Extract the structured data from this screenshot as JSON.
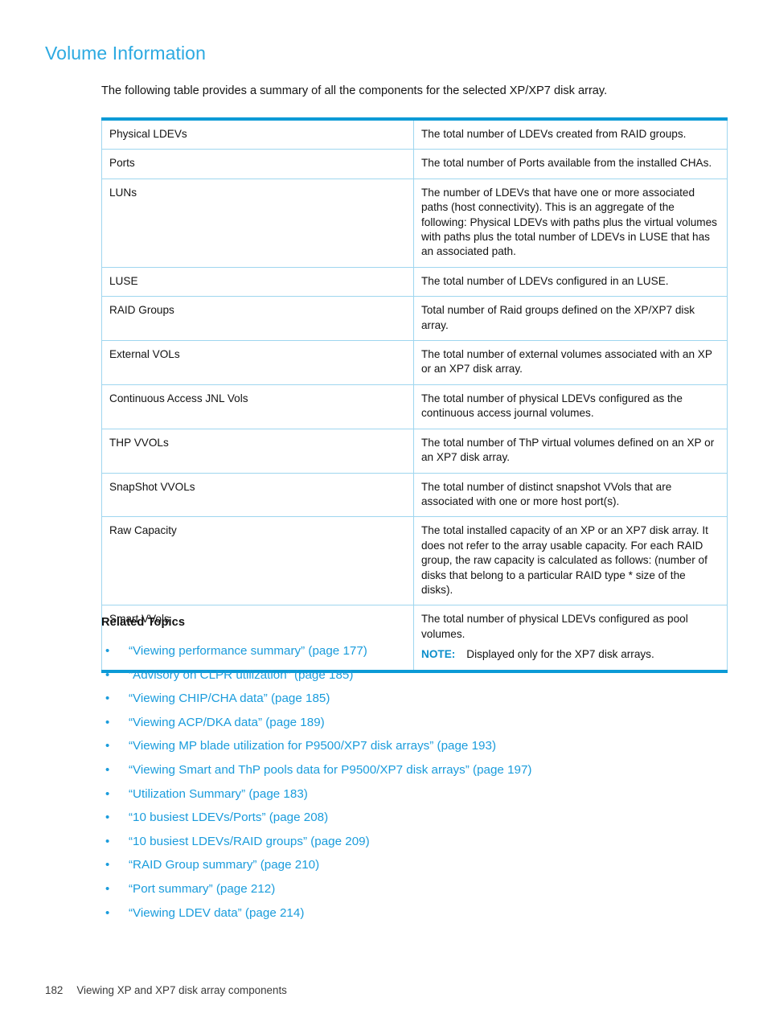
{
  "heading": "Volume Information",
  "intro": "The following table provides a summary of all the components for the selected XP/XP7 disk array.",
  "colors": {
    "accent_blue": "#0b9ad6",
    "heading_blue": "#2daae1",
    "link_blue": "#1a9cdc",
    "table_border_light": "#9fd6ef"
  },
  "table": {
    "rows": [
      {
        "term": "Physical LDEVs",
        "desc": "The total number of LDEVs created from RAID groups."
      },
      {
        "term": "Ports",
        "desc": "The total number of Ports available from the installed CHAs."
      },
      {
        "term": "LUNs",
        "desc": "The number of LDEVs that have one or more associated paths (host connectivity). This is an aggregate of the following: Physical LDEVs with paths plus the virtual volumes with paths plus the total number of LDEVs in LUSE that has an associated path."
      },
      {
        "term": "LUSE",
        "desc": "The total number of LDEVs configured in an LUSE."
      },
      {
        "term": "RAID Groups",
        "desc": "Total number of Raid groups defined on the XP/XP7 disk array."
      },
      {
        "term": "External VOLs",
        "desc": "The total number of external volumes associated with an XP or an XP7 disk array."
      },
      {
        "term": "Continuous Access JNL Vols",
        "desc": "The total number of physical LDEVs configured as the continuous access journal volumes."
      },
      {
        "term": "THP VVOLs",
        "desc": "The total number of ThP virtual volumes defined on an XP or an XP7 disk array."
      },
      {
        "term": "SnapShot VVOLs",
        "desc": "The total number of distinct snapshot VVols that are associated with one or more host port(s)."
      },
      {
        "term": "Raw Capacity",
        "desc": "The total installed capacity of an XP or an XP7 disk array. It does not refer to the array usable capacity. For each RAID group, the raw capacity is calculated as follows: (number of disks that belong to a particular RAID type * size of the disks)."
      },
      {
        "term": "Smart VVols",
        "desc": "The total number of physical LDEVs configured as pool volumes.",
        "note_label": "NOTE:",
        "note_text": "Displayed only for the XP7 disk arrays."
      }
    ]
  },
  "related": {
    "heading": "Related Topics",
    "bullet_glyph": "•",
    "items": [
      "“Viewing performance summary” (page 177)",
      "“Advisory on CLPR utilization” (page 185)",
      "“Viewing CHIP/CHA data” (page 185)",
      "“Viewing ACP/DKA data” (page 189)",
      "“Viewing MP blade utilization for P9500/XP7 disk arrays” (page 193)",
      "“Viewing Smart and ThP pools data for P9500/XP7 disk arrays” (page 197)",
      "“Utilization Summary” (page 183)",
      "“10 busiest LDEVs/Ports” (page 208)",
      "“10 busiest LDEVs/RAID groups” (page 209)",
      "“RAID Group summary” (page 210)",
      "“Port summary” (page 212)",
      "“Viewing LDEV data” (page 214)"
    ]
  },
  "footer": {
    "page_number": "182",
    "section_title": "Viewing XP and XP7 disk array components"
  }
}
